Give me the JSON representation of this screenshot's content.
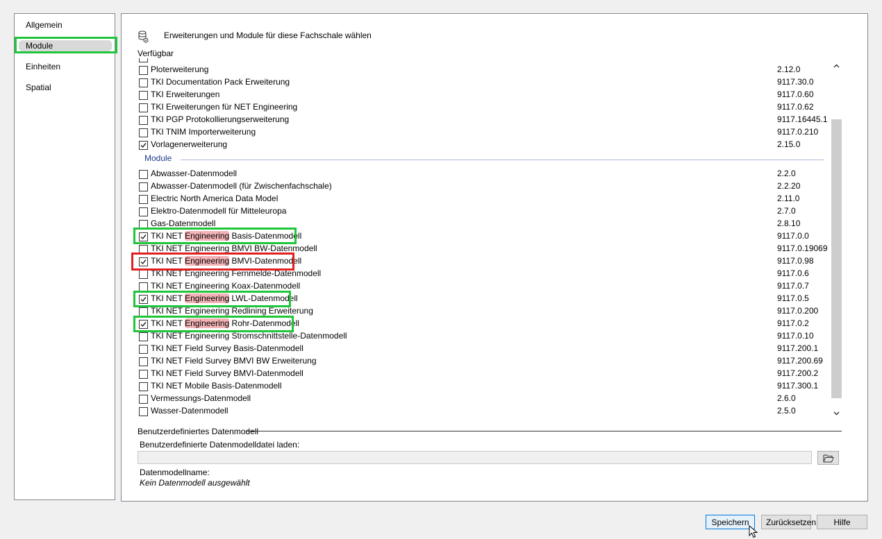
{
  "nav": {
    "items": [
      {
        "label": "Allgemein"
      },
      {
        "label": "Module",
        "selected": true
      },
      {
        "label": "Einheiten"
      },
      {
        "label": "Spatial"
      }
    ]
  },
  "header": {
    "icon": "database-settings-icon",
    "text": "Erweiterungen und Module für diese Fachschale wählen"
  },
  "available_label": "Verfügbar",
  "extensions": [
    {
      "name": "Ploterweiterung",
      "version": "2.12.0",
      "checked": false
    },
    {
      "name": "TKI Documentation Pack Erweiterung",
      "version": "9117.30.0",
      "checked": false
    },
    {
      "name": "TKI Erweiterungen",
      "version": "9117.0.60",
      "checked": false
    },
    {
      "name": "TKI Erweiterungen für NET Engineering",
      "version": "9117.0.62",
      "checked": false
    },
    {
      "name": "TKI PGP Protokollierungserweiterung",
      "version": "9117.16445.1",
      "checked": false
    },
    {
      "name": "TKI TNIM Importerweiterung",
      "version": "9117.0.210",
      "checked": false
    },
    {
      "name": "Vorlagenerweiterung",
      "version": "2.15.0",
      "checked": true
    }
  ],
  "modules_label": "Module",
  "modules": [
    {
      "name": "Abwasser-Datenmodell",
      "version": "2.2.0",
      "checked": false
    },
    {
      "name": "Abwasser-Datenmodell (für Zwischenfachschale)",
      "version": "2.2.20",
      "checked": false
    },
    {
      "name": "Electric North America Data Model",
      "version": "2.11.0",
      "checked": false
    },
    {
      "name": "Elektro-Datenmodell für Mitteleuropa",
      "version": "2.7.0",
      "checked": false
    },
    {
      "name": "Gas-Datenmodell",
      "version": "2.8.10",
      "checked": false
    },
    {
      "name_pre": "TKI NET ",
      "name_mark": "Engineering",
      "name_post": " Basis-Datenmodell",
      "version": "9117.0.0",
      "checked": true
    },
    {
      "name": "TKI NET Engineering BMVI BW-Datenmodell",
      "version": "9117.0.19069",
      "checked": false
    },
    {
      "name_pre": "TKI NET ",
      "name_mark": "Engineering",
      "name_post": " BMVI-Datenmodell",
      "version": "9117.0.98",
      "checked": true
    },
    {
      "name": "TKI NET Engineering Fernmelde-Datenmodell",
      "version": "9117.0.6",
      "checked": false
    },
    {
      "name": "TKI NET Engineering Koax-Datenmodell",
      "version": "9117.0.7",
      "checked": false
    },
    {
      "name_pre": "TKI NET ",
      "name_mark": "Engineering",
      "name_post": " LWL-Datenmodell",
      "version": "9117.0.5",
      "checked": true
    },
    {
      "name": "TKI NET Engineering Redlining Erweiterung",
      "version": "9117.0.200",
      "checked": false
    },
    {
      "name_pre": "TKI NET ",
      "name_mark": "Engineering",
      "name_post": " Rohr-Datenmodell",
      "version": "9117.0.2",
      "checked": true
    },
    {
      "name": "TKI NET Engineering Stromschnittstelle-Datenmodell",
      "version": "9117.0.10",
      "checked": false
    },
    {
      "name": "TKI NET Field Survey Basis-Datenmodell",
      "version": "9117.200.1",
      "checked": false
    },
    {
      "name": "TKI NET Field Survey BMVI BW Erweiterung",
      "version": "9117.200.69",
      "checked": false
    },
    {
      "name": "TKI NET Field Survey BMVI-Datenmodell",
      "version": "9117.200.2",
      "checked": false
    },
    {
      "name": "TKI NET Mobile Basis-Datenmodell",
      "version": "9117.300.1",
      "checked": false
    },
    {
      "name": "Vermessungs-Datenmodell",
      "version": "2.6.0",
      "checked": false
    },
    {
      "name": "Wasser-Datenmodell",
      "version": "2.5.0",
      "checked": false
    }
  ],
  "custom": {
    "title": "Benutzerdefiniertes Datenmodell",
    "file_label": "Benutzerdefinierte Datenmodelldatei laden:",
    "file_value": "",
    "browse_icon": "folder-open-icon",
    "model_name_label": "Datenmodellname:",
    "model_name_value": "Kein Datenmodell ausgewählt"
  },
  "buttons": {
    "save": "Speichern",
    "reset": "Zurücksetzen",
    "help": "Hilfe"
  },
  "colors": {
    "highlight_green": "#1fc53a",
    "highlight_red": "#e02020",
    "text_mark": "#f3b3b6",
    "section_label": "#1f3c88"
  }
}
